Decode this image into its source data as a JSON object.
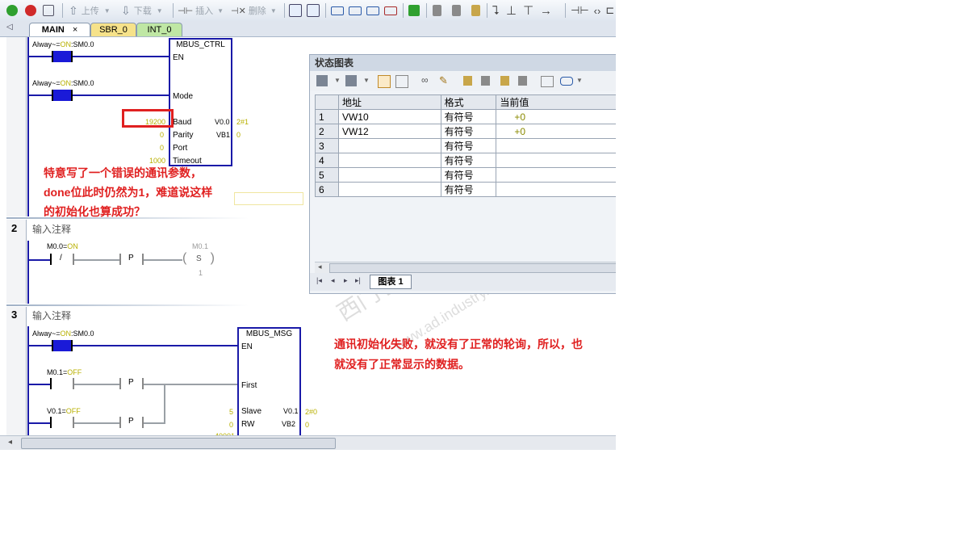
{
  "toolbar": {
    "upload": "上传",
    "download": "下载",
    "insert": "插入",
    "delete": "删除"
  },
  "tabs": [
    {
      "label": "MAIN",
      "close": "×"
    },
    {
      "label": "SBR_0"
    },
    {
      "label": "INT_0"
    }
  ],
  "networks": {
    "n1": {
      "contact1_label_a": "Alway~=",
      "contact1_label_b": "ON",
      "contact1_label_c": ":SM0.0",
      "contact2_label_a": "Alway~=",
      "contact2_label_b": "ON",
      "contact2_label_c": ":SM0.0",
      "box_title": "MBUS_CTRL",
      "pins": {
        "en": "EN",
        "mode": "Mode",
        "baud": "Baud",
        "parity": "Parity",
        "port": "Port",
        "timeout": "Timeout"
      },
      "inputs": {
        "baud": "19200",
        "parity": "0",
        "port": "0",
        "timeout": "1000"
      },
      "outputs": {
        "done_addr": "V0.0",
        "done_val": "2#1",
        "err_addr": "VB1",
        "err_val": "0"
      }
    },
    "n2": {
      "num": "2",
      "comment": "输入注释",
      "contact_label_a": "M0.0=",
      "contact_label_b": "ON",
      "coil_addr": "M0.1",
      "p_label": "P",
      "neg_label": "/",
      "coil_label": "S",
      "coil_count": "1"
    },
    "n3": {
      "num": "3",
      "comment": "输入注释",
      "contact1_label_a": "Alway~=",
      "contact1_label_b": "ON",
      "contact1_label_c": ":SM0.0",
      "contact2_label_a": "M0.1=",
      "contact2_label_b": "OFF",
      "contact3_label_a": "V0.1=",
      "contact3_label_b": "OFF",
      "p_label": "P",
      "box_title": "MBUS_MSG",
      "pins": {
        "en": "EN",
        "first": "First",
        "slave": "Slave",
        "rw": "RW"
      },
      "inputs": {
        "slave": "5",
        "rw": "0",
        "addr_partial": "40001"
      },
      "outputs": {
        "done_addr": "V0.1",
        "done_val": "2#0",
        "err_addr": "VB2",
        "err_val": "0"
      }
    }
  },
  "annotations": {
    "note1_line1": "特意写了一个错误的通讯参数，",
    "note1_line2": "done位此时仍然为1，难道说这样",
    "note1_line3": "的初始化也算成功？",
    "note2_line1": "通讯初始化失败，就没有了正常的轮询，所以，也",
    "note2_line2": "就没有了正常显示的数据。"
  },
  "status_chart": {
    "title": "状态图表",
    "columns": [
      "地址",
      "格式",
      "当前值"
    ],
    "rows": [
      {
        "n": "1",
        "addr": "VW10",
        "fmt": "有符号",
        "val": "+0"
      },
      {
        "n": "2",
        "addr": "VW12",
        "fmt": "有符号",
        "val": "+0"
      },
      {
        "n": "3",
        "addr": "",
        "fmt": "有符号",
        "val": ""
      },
      {
        "n": "4",
        "addr": "",
        "fmt": "有符号",
        "val": ""
      },
      {
        "n": "5",
        "addr": "",
        "fmt": "有符号",
        "val": ""
      },
      {
        "n": "6",
        "addr": "",
        "fmt": "有符号",
        "val": ""
      }
    ],
    "sheet_tab": "图表 1"
  },
  "watermark": {
    "line1": "西门子工业 技术论坛",
    "line2": "www.ad.industry.siemens.com/cs"
  },
  "colors": {
    "accent": "#1a1aa8",
    "annotation": "#e02020",
    "value": "#b8b000"
  }
}
